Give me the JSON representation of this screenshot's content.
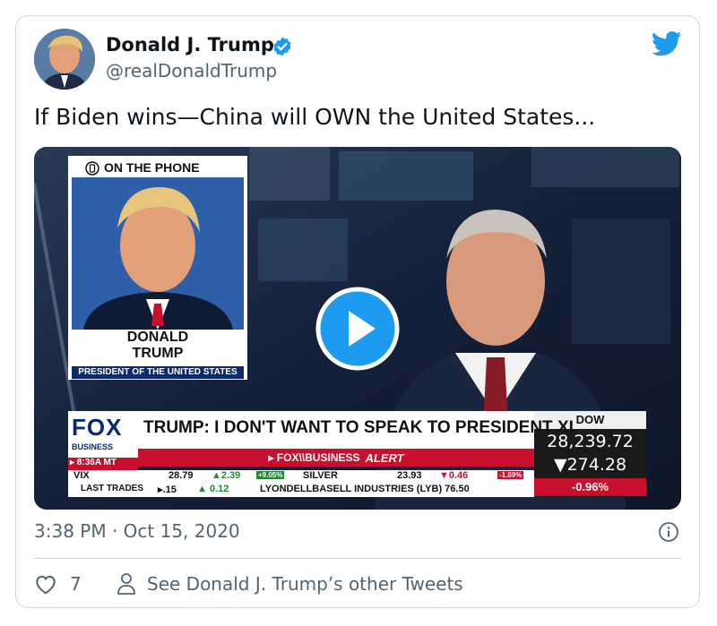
{
  "tweet": {
    "author_name": "Donald J. Trump",
    "author_handle": "@realDonaldTrump",
    "text": "If Biden wins—China will OWN the United States...",
    "timestamp": "3:38 PM · Oct 15, 2020",
    "likes": "7",
    "see_more": "See Donald J. Trump’s other Tweets"
  },
  "video": {
    "on_the_phone": "ON THE PHONE",
    "guest_first": "DONALD",
    "guest_last": "TRUMP",
    "guest_title": "PRESIDENT OF THE UNITED STATES",
    "network_main": "FOX",
    "network_sub": "BUSINESS",
    "clock": "▸ 8:36A MT",
    "headline": "TRUMP: I DON'T WANT TO SPEAK TO PRESIDENT XI",
    "alert_brand": "▸ FOX\\\\BUSINESS",
    "alert_word": "ALERT",
    "vix_label": "VIX",
    "vix_value": "28.79",
    "vix_change": "▲2.39",
    "vix_pct": "+9.05%",
    "silver_label": "SILVER",
    "silver_value": "23.93",
    "silver_change": "▼0.46",
    "silver_pct": "-1.89%",
    "last_trades": "LAST TRADES",
    "trade1": "▸.15",
    "trade1_change": "▲ 0.12",
    "trade2": "LYONDELLBASELL INDUSTRIES (LYB) 76.50",
    "dow_label": "DOW",
    "dow_value": "28,239.72",
    "dow_change": "▼274.28",
    "dow_pct": "-0.96%"
  },
  "colors": {
    "verified": "#1d9bf0",
    "twitter": "#1d9bf0",
    "play": "#1d9bf0",
    "fox_red": "#c8102e",
    "dow_red": "#d61a1a"
  }
}
